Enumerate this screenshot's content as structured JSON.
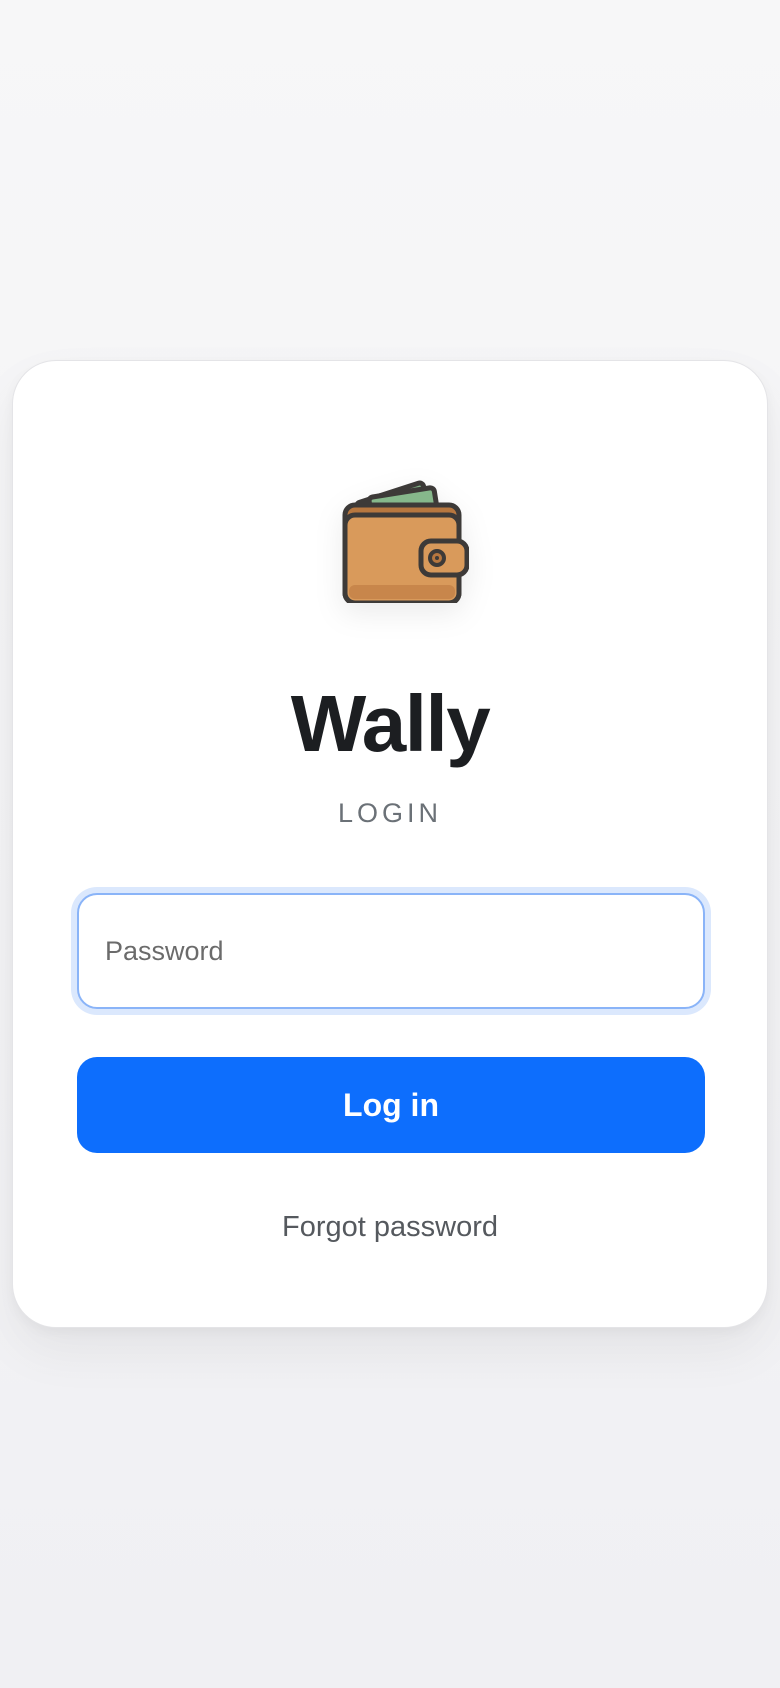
{
  "app": {
    "title": "Wally",
    "subtitle": "LOGIN",
    "logo_icon": "wallet-icon"
  },
  "form": {
    "password_placeholder": "Password",
    "password_value": "",
    "login_label": "Log in",
    "forgot_label": "Forgot password"
  },
  "colors": {
    "accent": "#0d6efd",
    "focus_ring": "#8ab4f8",
    "title_text": "#1c1e21",
    "subtitle_text": "#6b7177",
    "wallet_body": "#d99a5b",
    "cash": "#7fb184"
  }
}
